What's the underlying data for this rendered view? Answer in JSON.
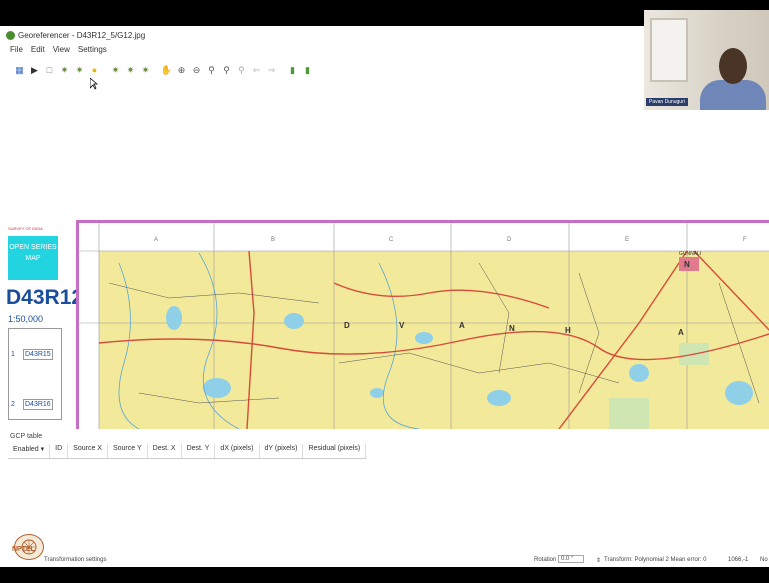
{
  "window": {
    "title": "Georeferencer - D43R12_5/G12.jpg"
  },
  "menu": [
    "File",
    "Edit",
    "View",
    "Settings"
  ],
  "toolbar": {
    "icons": [
      "open-raster-icon",
      "start-georef-icon",
      "generate-script-icon",
      "load-gcp-icon",
      "save-gcp-icon",
      "settings-icon",
      "add-point-icon",
      "delete-point-icon",
      "move-point-icon",
      "pan-icon",
      "zoom-in-icon",
      "zoom-out-icon",
      "zoom-layer-icon",
      "zoom-last-icon",
      "zoom-next-icon",
      "link-georef-icon",
      "link-qgis-icon"
    ]
  },
  "webcam": {
    "name": "Pavan Dunuguri"
  },
  "map": {
    "top_grid_letters": [
      "A",
      "B",
      "C",
      "D",
      "E",
      "F"
    ],
    "place_labels": [
      "D",
      "V",
      "A",
      "N",
      "H",
      "A"
    ],
    "town_label": "GUNNALI",
    "colors": {
      "map_yellow": "#f2e99a",
      "frame": "#c66ec6",
      "road_red": "#d84a3a"
    }
  },
  "legend_panel": {
    "header": "SURVEY OF INDIA",
    "series": "OPEN SERIES MAP",
    "code": "D43R12",
    "scale": "1:50,000",
    "cells": [
      "1",
      "D43R15",
      "2",
      "D43R16"
    ]
  },
  "gcp_table": {
    "title": "GCP table",
    "columns": [
      "Enabled",
      "ID",
      "Source X",
      "Source Y",
      "Dest. X",
      "Dest. Y",
      "dX (pixels)",
      "dY (pixels)",
      "Residual (pixels)"
    ]
  },
  "status_bar": {
    "left_text": "Transformation settings",
    "rotation_label": "Rotation",
    "rotation_value": "0.0 °",
    "transform_text": "Transform: Polynomial 2 Mean error: 0",
    "coords_text": "1066,-1",
    "extra": "No"
  },
  "branding": {
    "logo_text": "NPTEL"
  }
}
